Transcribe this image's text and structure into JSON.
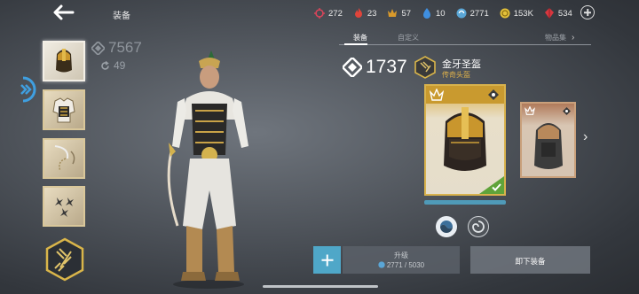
{
  "header": {
    "title": "装备"
  },
  "currencies": [
    {
      "icon": "red-ring-icon",
      "value": "272",
      "color": "#d6455a"
    },
    {
      "icon": "red-flame-icon",
      "value": "23",
      "color": "#e0443a"
    },
    {
      "icon": "gold-crown-icon",
      "value": "57",
      "color": "#d99a2b"
    },
    {
      "icon": "blue-drop-icon",
      "value": "10",
      "color": "#3f8fe0"
    },
    {
      "icon": "blue-coin-icon",
      "value": "2771",
      "color": "#5aa6d6"
    },
    {
      "icon": "gold-coin-icon",
      "value": "153K",
      "color": "#e3c13a"
    },
    {
      "icon": "red-gem-icon",
      "value": "534",
      "color": "#d8373f"
    }
  ],
  "character": {
    "power": "7567",
    "sub_value": "49"
  },
  "tabs": [
    {
      "label": "装备",
      "active": true
    },
    {
      "label": "自定义",
      "active": false
    },
    {
      "label": "物品集",
      "active": false
    }
  ],
  "item": {
    "power": "1737",
    "name": "金牙圣盔",
    "type": "传奇头盔"
  },
  "actions": {
    "upgrade_label": "升级",
    "upgrade_cost": "2771 / 5030",
    "unequip_label": "卸下装备"
  },
  "colors": {
    "accent_gold": "#d8b24d",
    "accent_blue": "#4fa7c8",
    "legendary_text": "#e0b24a"
  }
}
